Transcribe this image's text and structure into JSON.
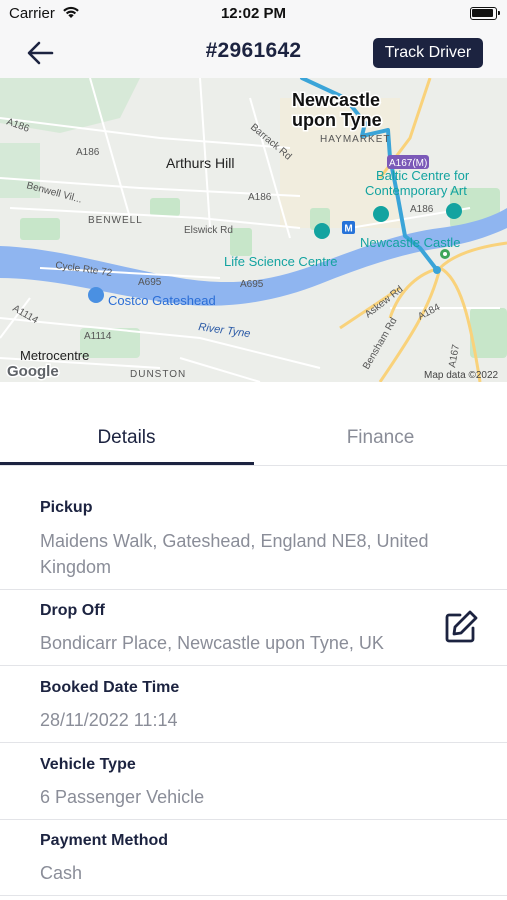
{
  "status_bar": {
    "carrier": "Carrier",
    "time": "12:02 PM"
  },
  "header": {
    "title": "#2961642",
    "track_button": "Track Driver"
  },
  "map": {
    "labels": {
      "newcastle_1": "Newcastle",
      "newcastle_2": "upon Tyne",
      "haymarket": "HAYMARKET",
      "arthurs_hill": "Arthurs Hill",
      "benwell": "BENWELL",
      "benwell_village": "Benwell Vil...",
      "life_science": "Life Science Centre",
      "baltic_1": "Baltic Centre for",
      "baltic_2": "Contemporary Art",
      "newcastle_castle": "Newcastle Castle",
      "costco": "Costco Gateshead",
      "river_tyne": "River Tyne",
      "metrocentre": "Metrocentre",
      "dunston": "DUNSTON",
      "a186_1": "A186",
      "a186_2": "A186",
      "a186_3": "A186",
      "a186_4": "A186",
      "barrack_rd": "Barrack Rd",
      "elswick_rd": "Elswick Rd",
      "cycle_rte": "Cycle Rte 72",
      "a695_1": "A695",
      "a695_2": "A695",
      "a1114_1": "A1114",
      "a1114_2": "A1114",
      "a167m": "A167(M)",
      "askew_rd": "Askew Rd",
      "a184": "A184",
      "bensham_rd": "Bensham Rd",
      "a167": "A167",
      "metro_m": "M",
      "google": "Google",
      "map_data": "Map data ©2022"
    },
    "colors": {
      "route": "#3aa4d8",
      "water": "#8fb5f0",
      "park": "#c7e6c9",
      "road_major": "#f9d27b"
    }
  },
  "tabs": {
    "details": "Details",
    "finance": "Finance",
    "active": "details"
  },
  "details": {
    "pickup": {
      "label": "Pickup",
      "value": "Maidens Walk, Gateshead, England NE8, United Kingdom"
    },
    "dropoff": {
      "label": "Drop Off",
      "value": "Bondicarr Place, Newcastle upon Tyne, UK"
    },
    "booked": {
      "label": "Booked Date Time",
      "value": "28/11/2022 11:14"
    },
    "vehicle": {
      "label": "Vehicle Type",
      "value": "6 Passenger Vehicle"
    },
    "payment": {
      "label": "Payment Method",
      "value": "Cash"
    }
  },
  "icons": {
    "back": "arrow-left-icon",
    "edit": "edit-icon",
    "wifi": "wifi-icon",
    "battery": "battery-icon"
  }
}
